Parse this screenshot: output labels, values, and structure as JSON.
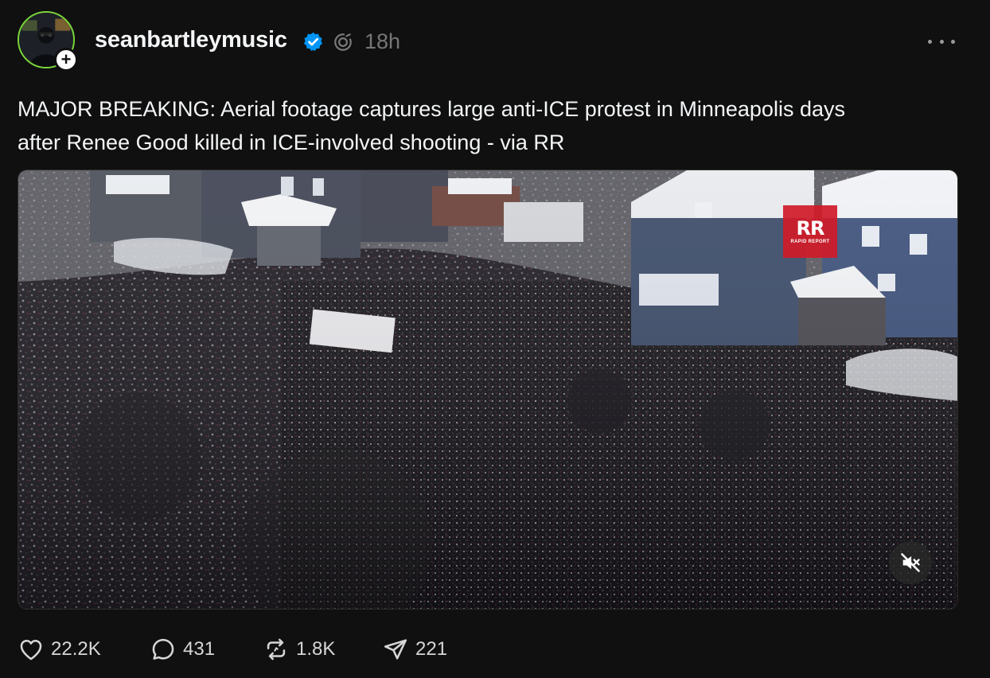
{
  "post": {
    "username": "seanbartleymusic",
    "timestamp": "18h",
    "caption_line1": "MAJOR BREAKING: Aerial footage captures large anti-ICE protest in Minneapolis days",
    "caption_line2": "after Renee Good killed in ICE-involved shooting - via RR",
    "follow_symbol": "+",
    "verified": true
  },
  "media": {
    "watermark_mark": "RR",
    "watermark_sub": "RAPID REPORT",
    "muted": true
  },
  "actions": {
    "likes": "22.2K",
    "replies": "431",
    "reposts": "1.8K",
    "shares": "221"
  },
  "icons": {
    "verified": "verified-badge-icon",
    "activity": "threads-activity-icon",
    "more": "more-options-icon",
    "like": "heart-icon",
    "reply": "comment-bubble-icon",
    "repost": "repost-arrows-icon",
    "share": "send-paper-plane-icon",
    "mute": "speaker-muted-icon"
  },
  "colors": {
    "background": "#101010",
    "text": "#f3f5f7",
    "muted_text": "#777777",
    "verified_blue": "#0095f6",
    "avatar_ring": "#7bd63a",
    "watermark_red": "#d01a28"
  }
}
